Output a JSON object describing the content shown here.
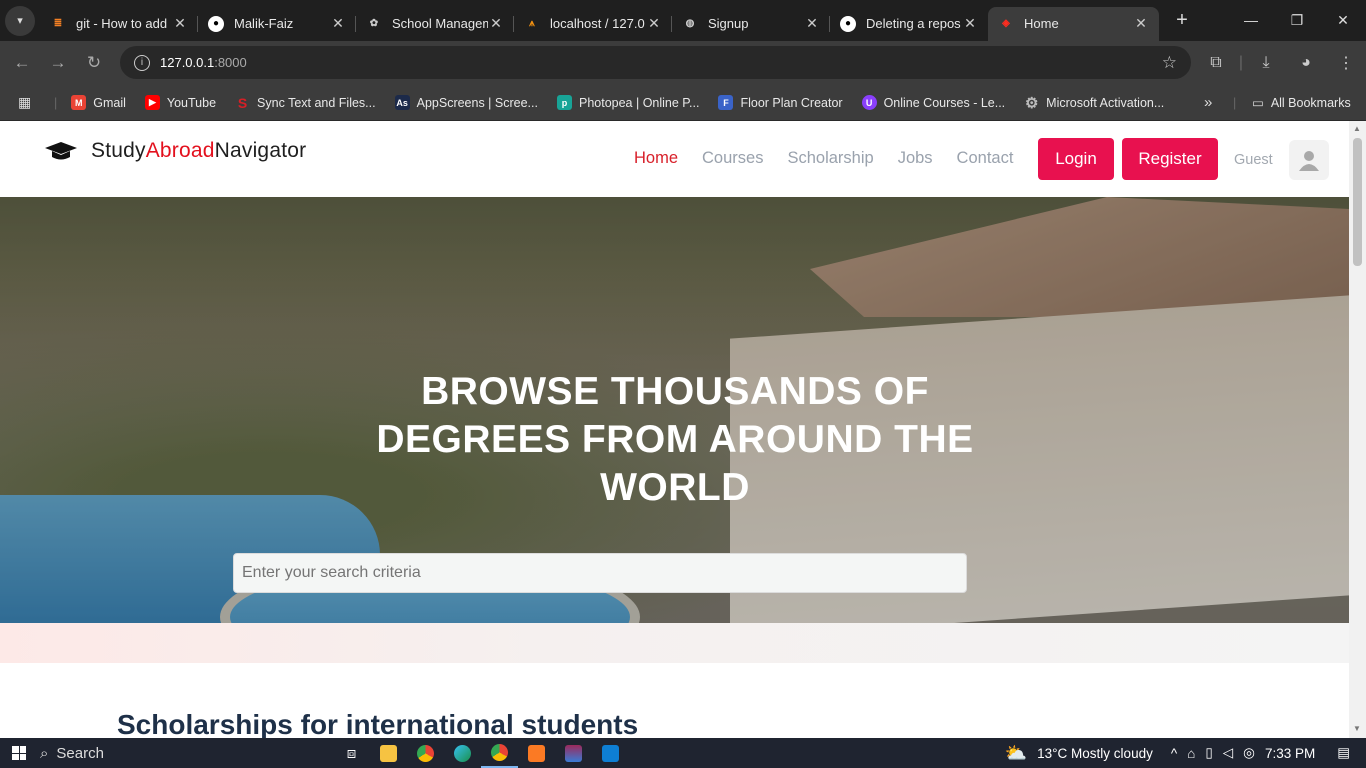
{
  "browser": {
    "tabs": [
      {
        "title": "git - How to add",
        "icon": "stackoverflow-icon",
        "color": "#f48024"
      },
      {
        "title": "Malik-Faiz",
        "icon": "github-icon",
        "color": "#ffffff"
      },
      {
        "title": "School Managem",
        "icon": "openai-icon",
        "color": "#cccccc"
      },
      {
        "title": "localhost / 127.0",
        "icon": "phpmyadmin-icon",
        "color": "#f29111"
      },
      {
        "title": "Signup",
        "icon": "globe-icon",
        "color": "#cccccc"
      },
      {
        "title": "Deleting a repos",
        "icon": "github-icon",
        "color": "#ffffff"
      },
      {
        "title": "Home",
        "icon": "laravel-icon",
        "color": "#ff2d20"
      }
    ],
    "url_host": "127.0.0.1",
    "url_port": ":8000",
    "bookmarks": [
      {
        "label": "Gmail",
        "color": "#ea4335"
      },
      {
        "label": "YouTube",
        "color": "#ff0000"
      },
      {
        "label": "Sync Text and Files...",
        "color": "#d71f26"
      },
      {
        "label": "AppScreens | Scree...",
        "color": "#1c2a4a"
      },
      {
        "label": "Photopea | Online P...",
        "color": "#18a497"
      },
      {
        "label": "Floor Plan Creator",
        "color": "#3a63c8"
      },
      {
        "label": "Online Courses - Le...",
        "color": "#8a3ffc"
      },
      {
        "label": "Microsoft Activation...",
        "color": "#9a9a9a"
      }
    ],
    "all_bookmarks": "All Bookmarks"
  },
  "site": {
    "brand_pre": "Study",
    "brand_mid": "Abroad",
    "brand_post": "Navigator",
    "nav": [
      "Home",
      "Courses",
      "Scholarship",
      "Jobs",
      "Contact"
    ],
    "login": "Login",
    "register": "Register",
    "guest": "Guest",
    "hero_title": "BROWSE THOUSANDS OF DEGREES FROM AROUND THE WORLD",
    "search_placeholder": "Enter your search criteria",
    "section_title": "Scholarships for international students"
  },
  "taskbar": {
    "search": "Search",
    "weather": "13°C  Mostly cloudy",
    "time": "7:33 PM"
  }
}
